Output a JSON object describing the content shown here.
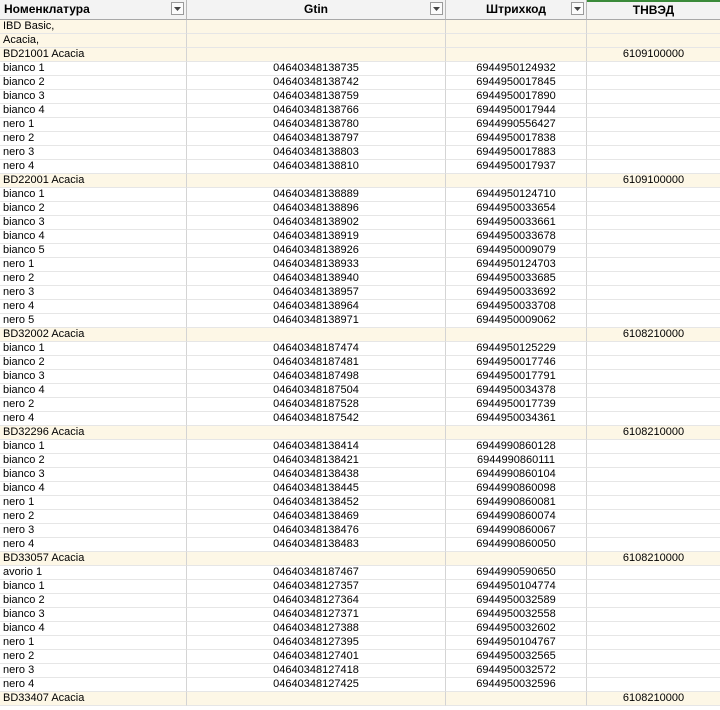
{
  "headers": {
    "col0": "Номенклатура",
    "col1": "Gtin",
    "col2": "Штрихкод",
    "col3": "ТНВЭД"
  },
  "rows": [
    {
      "type": "group",
      "c0": "IBD Basic,",
      "c1": "",
      "c2": "",
      "c3": ""
    },
    {
      "type": "group",
      "c0": "Acacia,",
      "c1": "",
      "c2": "",
      "c3": ""
    },
    {
      "type": "group",
      "c0": "BD21001 Acacia",
      "c1": "",
      "c2": "",
      "c3": "6109100000"
    },
    {
      "type": "item",
      "c0": "bianco 1",
      "c1": "04640348138735",
      "c2": "6944950124932",
      "c3": ""
    },
    {
      "type": "item",
      "c0": "bianco 2",
      "c1": "04640348138742",
      "c2": "6944950017845",
      "c3": ""
    },
    {
      "type": "item",
      "c0": "bianco 3",
      "c1": "04640348138759",
      "c2": "6944950017890",
      "c3": ""
    },
    {
      "type": "item",
      "c0": "bianco 4",
      "c1": "04640348138766",
      "c2": "6944950017944",
      "c3": ""
    },
    {
      "type": "item",
      "c0": "nero 1",
      "c1": "04640348138780",
      "c2": "6944990556427",
      "c3": ""
    },
    {
      "type": "item",
      "c0": "nero 2",
      "c1": "04640348138797",
      "c2": "6944950017838",
      "c3": ""
    },
    {
      "type": "item",
      "c0": "nero 3",
      "c1": "04640348138803",
      "c2": "6944950017883",
      "c3": ""
    },
    {
      "type": "item",
      "c0": "nero 4",
      "c1": "04640348138810",
      "c2": "6944950017937",
      "c3": ""
    },
    {
      "type": "group",
      "c0": "BD22001 Acacia",
      "c1": "",
      "c2": "",
      "c3": "6109100000"
    },
    {
      "type": "item",
      "c0": "bianco 1",
      "c1": "04640348138889",
      "c2": "6944950124710",
      "c3": ""
    },
    {
      "type": "item",
      "c0": "bianco 2",
      "c1": "04640348138896",
      "c2": "6944950033654",
      "c3": ""
    },
    {
      "type": "item",
      "c0": "bianco 3",
      "c1": "04640348138902",
      "c2": "6944950033661",
      "c3": ""
    },
    {
      "type": "item",
      "c0": "bianco 4",
      "c1": "04640348138919",
      "c2": "6944950033678",
      "c3": ""
    },
    {
      "type": "item",
      "c0": "bianco 5",
      "c1": "04640348138926",
      "c2": "6944950009079",
      "c3": ""
    },
    {
      "type": "item",
      "c0": "nero 1",
      "c1": "04640348138933",
      "c2": "6944950124703",
      "c3": ""
    },
    {
      "type": "item",
      "c0": "nero 2",
      "c1": "04640348138940",
      "c2": "6944950033685",
      "c3": ""
    },
    {
      "type": "item",
      "c0": "nero 3",
      "c1": "04640348138957",
      "c2": "6944950033692",
      "c3": ""
    },
    {
      "type": "item",
      "c0": "nero 4",
      "c1": "04640348138964",
      "c2": "6944950033708",
      "c3": ""
    },
    {
      "type": "item",
      "c0": "nero 5",
      "c1": "04640348138971",
      "c2": "6944950009062",
      "c3": ""
    },
    {
      "type": "group",
      "c0": "BD32002 Acacia",
      "c1": "",
      "c2": "",
      "c3": "6108210000"
    },
    {
      "type": "item",
      "c0": "bianco 1",
      "c1": "04640348187474",
      "c2": "6944950125229",
      "c3": ""
    },
    {
      "type": "item",
      "c0": "bianco 2",
      "c1": "04640348187481",
      "c2": "6944950017746",
      "c3": ""
    },
    {
      "type": "item",
      "c0": "bianco 3",
      "c1": "04640348187498",
      "c2": "6944950017791",
      "c3": ""
    },
    {
      "type": "item",
      "c0": "bianco 4",
      "c1": "04640348187504",
      "c2": "6944950034378",
      "c3": ""
    },
    {
      "type": "item",
      "c0": "nero 2",
      "c1": "04640348187528",
      "c2": "6944950017739",
      "c3": ""
    },
    {
      "type": "item",
      "c0": "nero 4",
      "c1": "04640348187542",
      "c2": "6944950034361",
      "c3": ""
    },
    {
      "type": "group",
      "c0": "BD32296 Acacia",
      "c1": "",
      "c2": "",
      "c3": "6108210000"
    },
    {
      "type": "item",
      "c0": "bianco 1",
      "c1": "04640348138414",
      "c2": "6944990860128",
      "c3": ""
    },
    {
      "type": "item",
      "c0": "bianco 2",
      "c1": "04640348138421",
      "c2": "6944990860111",
      "c3": ""
    },
    {
      "type": "item",
      "c0": "bianco 3",
      "c1": "04640348138438",
      "c2": "6944990860104",
      "c3": ""
    },
    {
      "type": "item",
      "c0": "bianco 4",
      "c1": "04640348138445",
      "c2": "6944990860098",
      "c3": ""
    },
    {
      "type": "item",
      "c0": "nero 1",
      "c1": "04640348138452",
      "c2": "6944990860081",
      "c3": ""
    },
    {
      "type": "item",
      "c0": "nero 2",
      "c1": "04640348138469",
      "c2": "6944990860074",
      "c3": ""
    },
    {
      "type": "item",
      "c0": "nero 3",
      "c1": "04640348138476",
      "c2": "6944990860067",
      "c3": ""
    },
    {
      "type": "item",
      "c0": "nero 4",
      "c1": "04640348138483",
      "c2": "6944990860050",
      "c3": ""
    },
    {
      "type": "group",
      "c0": "BD33057 Acacia",
      "c1": "",
      "c2": "",
      "c3": "6108210000"
    },
    {
      "type": "item",
      "c0": "avorio 1",
      "c1": "04640348187467",
      "c2": "6944990590650",
      "c3": ""
    },
    {
      "type": "item",
      "c0": "bianco 1",
      "c1": "04640348127357",
      "c2": "6944950104774",
      "c3": ""
    },
    {
      "type": "item",
      "c0": "bianco 2",
      "c1": "04640348127364",
      "c2": "6944950032589",
      "c3": ""
    },
    {
      "type": "item",
      "c0": "bianco 3",
      "c1": "04640348127371",
      "c2": "6944950032558",
      "c3": ""
    },
    {
      "type": "item",
      "c0": "bianco 4",
      "c1": "04640348127388",
      "c2": "6944950032602",
      "c3": ""
    },
    {
      "type": "item",
      "c0": "nero 1",
      "c1": "04640348127395",
      "c2": "6944950104767",
      "c3": ""
    },
    {
      "type": "item",
      "c0": "nero 2",
      "c1": "04640348127401",
      "c2": "6944950032565",
      "c3": ""
    },
    {
      "type": "item",
      "c0": "nero 3",
      "c1": "04640348127418",
      "c2": "6944950032572",
      "c3": ""
    },
    {
      "type": "item",
      "c0": "nero 4",
      "c1": "04640348127425",
      "c2": "6944950032596",
      "c3": ""
    },
    {
      "type": "group",
      "c0": "BD33407 Acacia",
      "c1": "",
      "c2": "",
      "c3": "6108210000"
    }
  ]
}
